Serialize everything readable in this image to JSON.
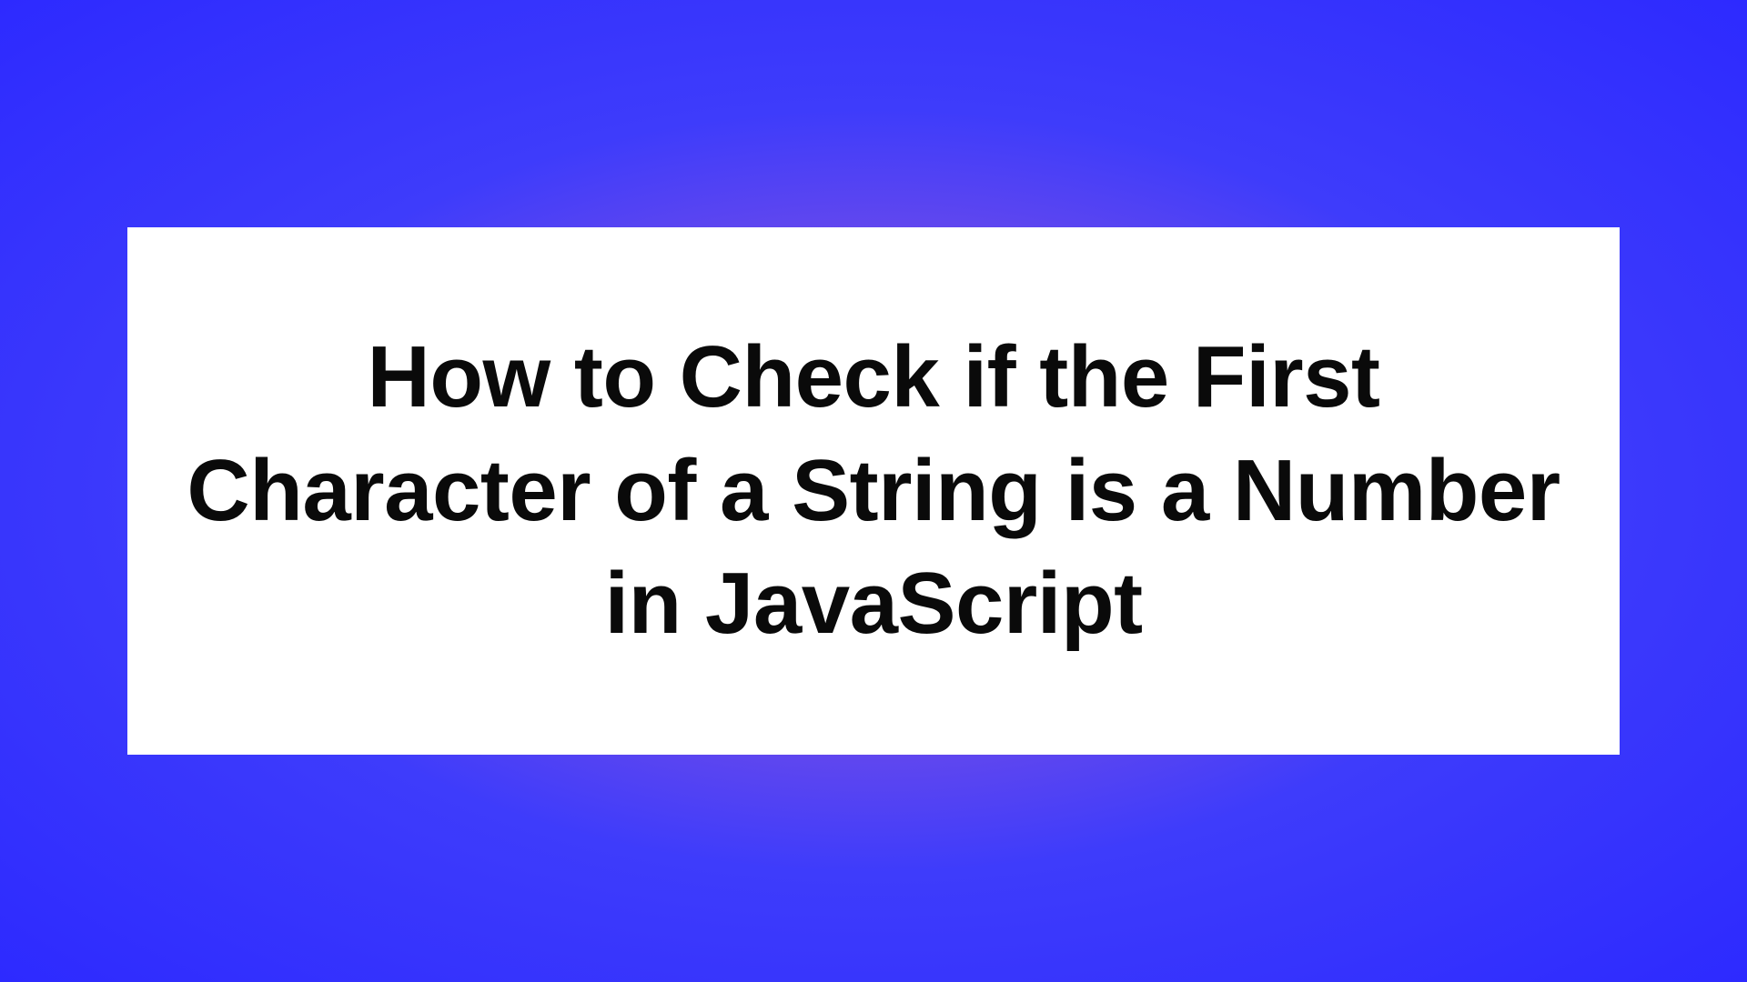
{
  "card": {
    "title": "How to Check if the First Character of a String is a Number in JavaScript"
  }
}
